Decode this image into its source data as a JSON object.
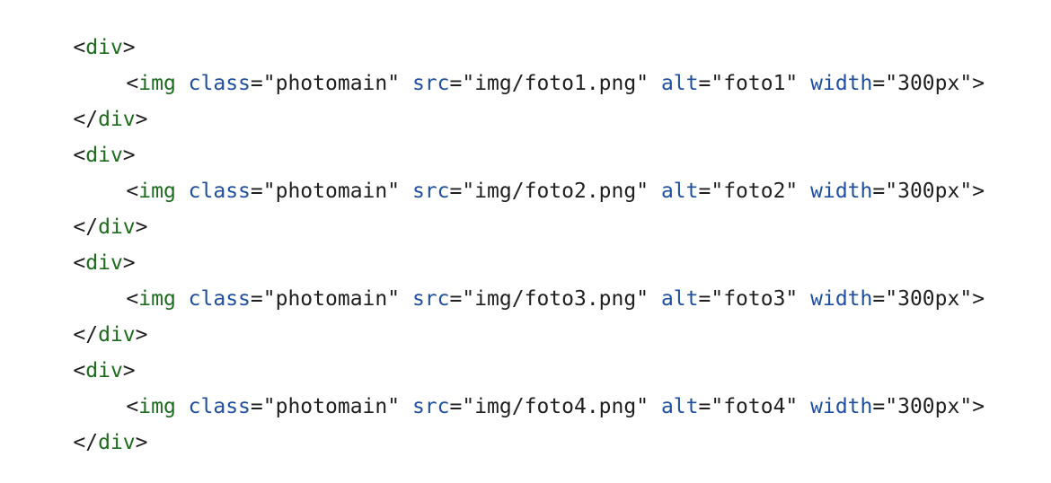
{
  "code_lines": [
    {
      "t": "open",
      "tag": "div"
    },
    {
      "t": "img",
      "tag": "img",
      "attrs": [
        {
          "name": "class",
          "value": "\"photomain\""
        },
        {
          "name": "src",
          "value": "\"img/foto1.png\""
        },
        {
          "name": "alt",
          "value": "\"foto1\""
        },
        {
          "name": "width",
          "value": "\"300px\""
        }
      ]
    },
    {
      "t": "close",
      "tag": "div"
    },
    {
      "t": "open",
      "tag": "div"
    },
    {
      "t": "img",
      "tag": "img",
      "attrs": [
        {
          "name": "class",
          "value": "\"photomain\""
        },
        {
          "name": "src",
          "value": "\"img/foto2.png\""
        },
        {
          "name": "alt",
          "value": "\"foto2\""
        },
        {
          "name": "width",
          "value": "\"300px\""
        }
      ]
    },
    {
      "t": "close",
      "tag": "div"
    },
    {
      "t": "open",
      "tag": "div"
    },
    {
      "t": "img",
      "tag": "img",
      "attrs": [
        {
          "name": "class",
          "value": "\"photomain\""
        },
        {
          "name": "src",
          "value": "\"img/foto3.png\""
        },
        {
          "name": "alt",
          "value": "\"foto3\""
        },
        {
          "name": "width",
          "value": "\"300px\""
        }
      ]
    },
    {
      "t": "close",
      "tag": "div"
    },
    {
      "t": "open",
      "tag": "div"
    },
    {
      "t": "img",
      "tag": "img",
      "attrs": [
        {
          "name": "class",
          "value": "\"photomain\""
        },
        {
          "name": "src",
          "value": "\"img/foto4.png\""
        },
        {
          "name": "alt",
          "value": "\"foto4\""
        },
        {
          "name": "width",
          "value": "\"300px\""
        }
      ]
    },
    {
      "t": "close",
      "tag": "div"
    }
  ],
  "colors": {
    "tag": "#1d6b1d",
    "attribute": "#1f4fa0",
    "text": "#1f1f1f",
    "background": "#ffffff"
  }
}
